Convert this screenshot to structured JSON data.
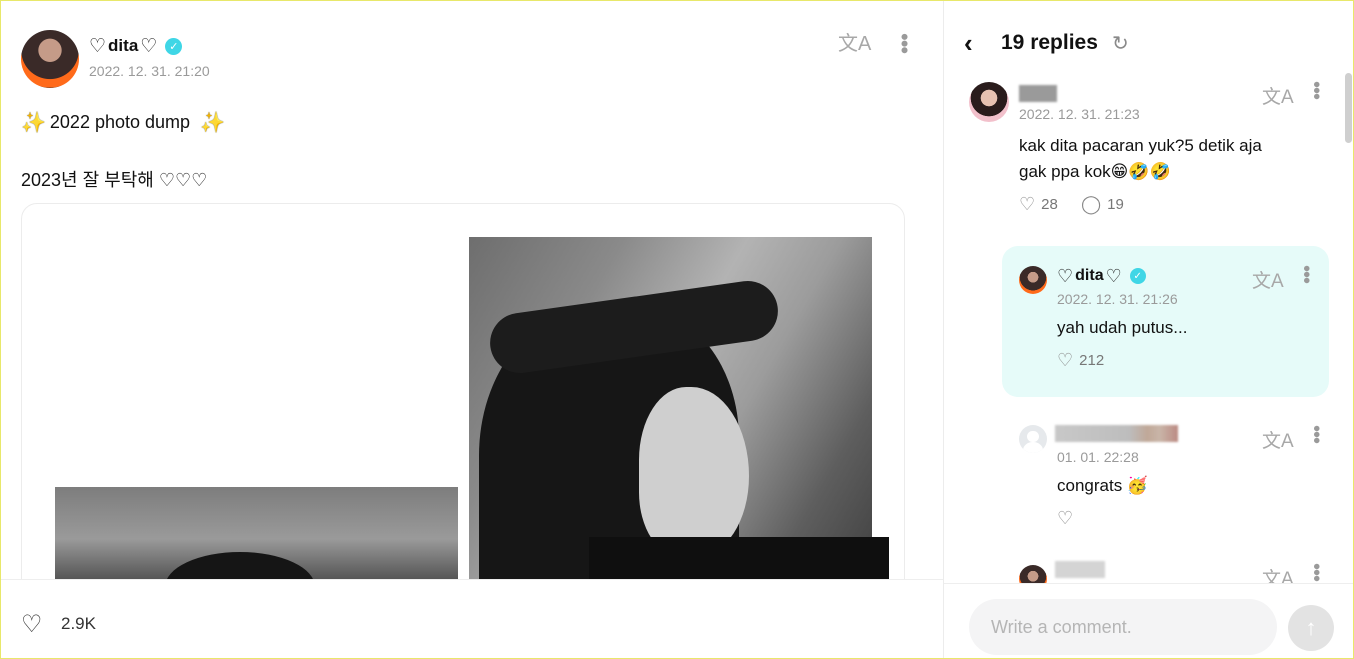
{
  "post": {
    "author_name": "dita",
    "date": "2022. 12. 31. 21:20",
    "line1": "2022 photo dump",
    "line2": "2023년 잘 부탁해 ♡♡♡",
    "like_count": "2.9K"
  },
  "replies_panel": {
    "title": "19 replies",
    "replies": [
      {
        "date": "2022. 12. 31. 21:23",
        "text_line1": "kak dita pacaran yuk?5 detik aja",
        "text_line2": "gak ppa kok😁🤣🤣",
        "likes": "28",
        "comments": "19"
      },
      {
        "author_name": "dita",
        "date": "2022. 12. 31. 21:26",
        "text": "yah udah putus...",
        "likes": "212"
      },
      {
        "date": "01. 01. 22:28",
        "text": "congrats 🥳"
      }
    ],
    "comment_placeholder": "Write a comment."
  },
  "icons": {
    "translate": "translate-icon",
    "more": "more-vertical-icon",
    "like": "heart-hand-icon",
    "comment": "comment-bubble-icon",
    "verified": "verified-badge-icon",
    "back": "chevron-left-icon",
    "refresh": "refresh-icon",
    "send": "arrow-up-icon"
  },
  "colors": {
    "verified": "#3fd6e6",
    "author_reply_bg": "#e6fbf9"
  }
}
